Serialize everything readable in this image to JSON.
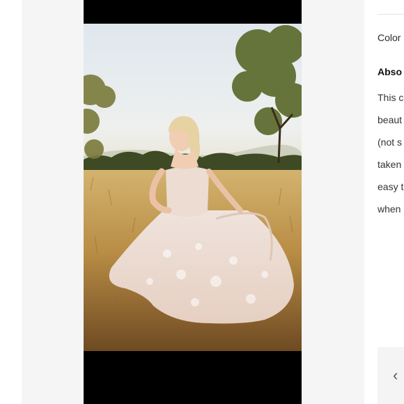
{
  "product_photo": {
    "alt_description": ""
  },
  "details": {
    "color_label": "Color",
    "section_heading": "Abso",
    "description_lines": [
      "This c",
      "beaut",
      "(not s",
      "taken",
      "easy t",
      "when"
    ]
  },
  "carousel": {
    "prev_icon": "chevron-left-icon",
    "prev_glyph": "‹"
  }
}
